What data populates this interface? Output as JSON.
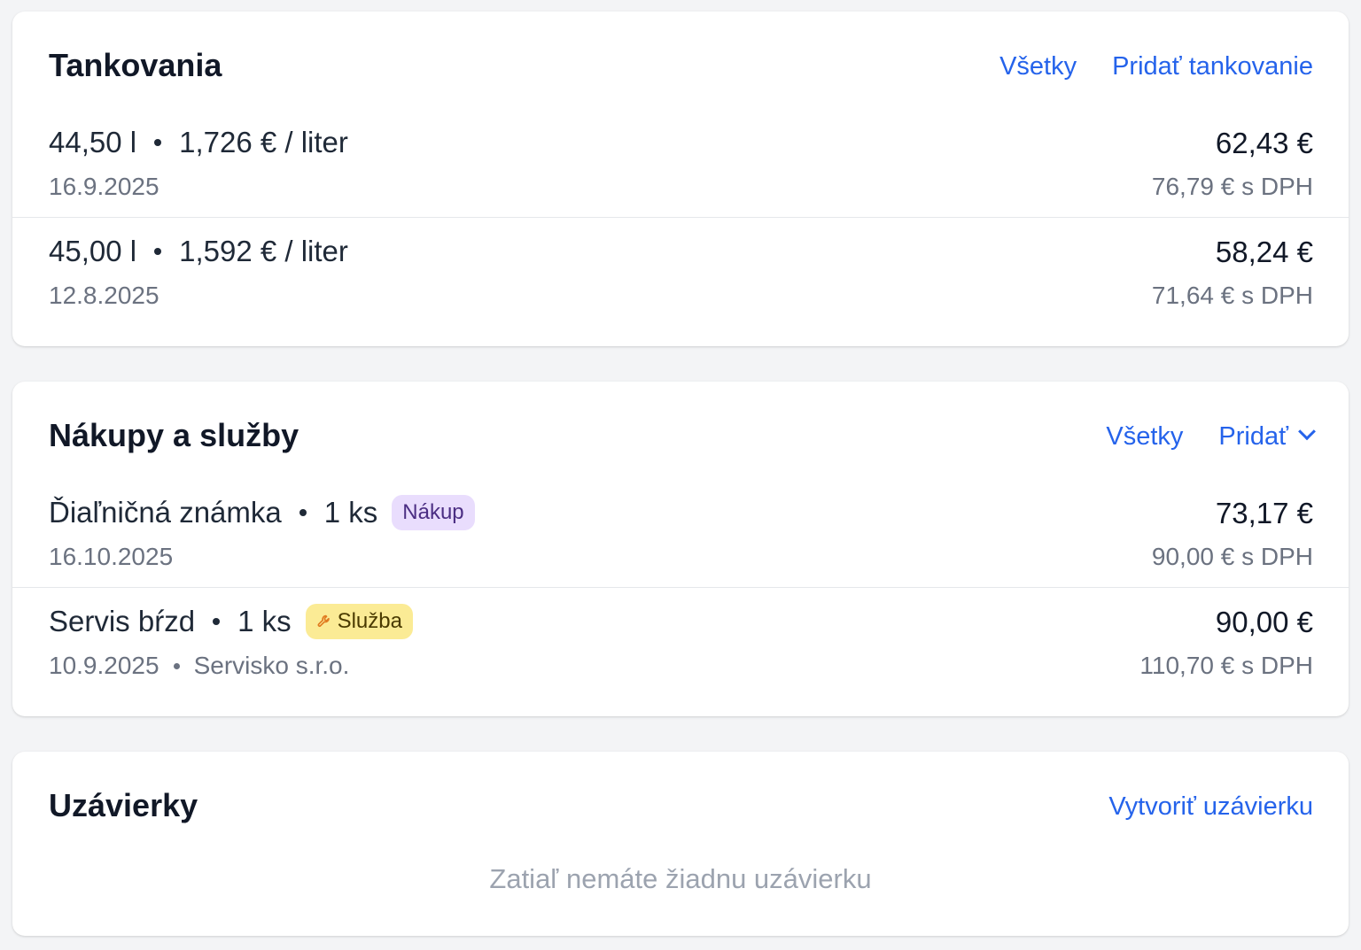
{
  "fuel": {
    "title": "Tankovania",
    "all_label": "Všetky",
    "add_label": "Pridať tankovanie",
    "rows": [
      {
        "liters": "44,50 l",
        "unit_price": "1,726 € / liter",
        "date": "16.9.2025",
        "price": "62,43 €",
        "price_vat": "76,79 € s DPH"
      },
      {
        "liters": "45,00 l",
        "unit_price": "1,592 € / liter",
        "date": "12.8.2025",
        "price": "58,24 €",
        "price_vat": "71,64 € s DPH"
      }
    ]
  },
  "purchases": {
    "title": "Nákupy a služby",
    "all_label": "Všetky",
    "add_label": "Pridať",
    "rows": [
      {
        "name": "Ďiaľničná známka",
        "qty": "1 ks",
        "badge": "Nákup",
        "date": "16.10.2025",
        "vendor": "",
        "price": "73,17 €",
        "price_vat": "90,00 € s DPH"
      },
      {
        "name": "Servis bŕzd",
        "qty": "1 ks",
        "badge": "Služba",
        "badge_icon": "wrench-icon",
        "date": "10.9.2025",
        "vendor": "Servisko s.r.o.",
        "price": "90,00 €",
        "price_vat": "110,70 € s DPH"
      }
    ]
  },
  "closings": {
    "title": "Uzávierky",
    "create_label": "Vytvoriť uzávierku",
    "empty_text": "Zatiaľ nemáte žiadnu uzávierku"
  },
  "colors": {
    "accent": "#2563eb",
    "background": "#f3f4f6",
    "badge_purchase": "#e9ddfd",
    "badge_service": "#fbeb95"
  }
}
